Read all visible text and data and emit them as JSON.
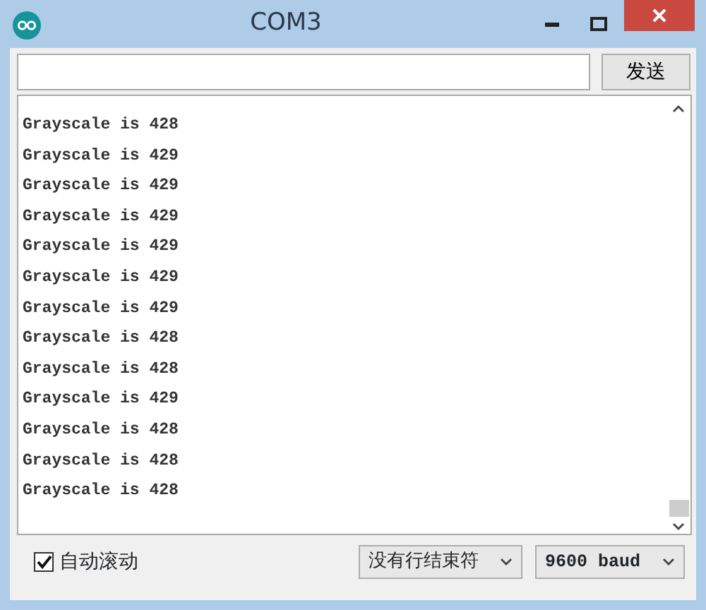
{
  "window": {
    "title": "COM3"
  },
  "send_button": {
    "label": "发送"
  },
  "output_lines": [
    "Grayscale is 428",
    "Grayscale is 429",
    "Grayscale is 429",
    "Grayscale is 429",
    "Grayscale is 429",
    "Grayscale is 429",
    "Grayscale is 429",
    "Grayscale is 428",
    "Grayscale is 428",
    "Grayscale is 429",
    "Grayscale is 428",
    "Grayscale is 428",
    "Grayscale is 428"
  ],
  "autoscroll": {
    "label": "自动滚动",
    "checked": true
  },
  "line_ending": {
    "value": "没有行结束符"
  },
  "baud": {
    "value": "9600 baud"
  }
}
